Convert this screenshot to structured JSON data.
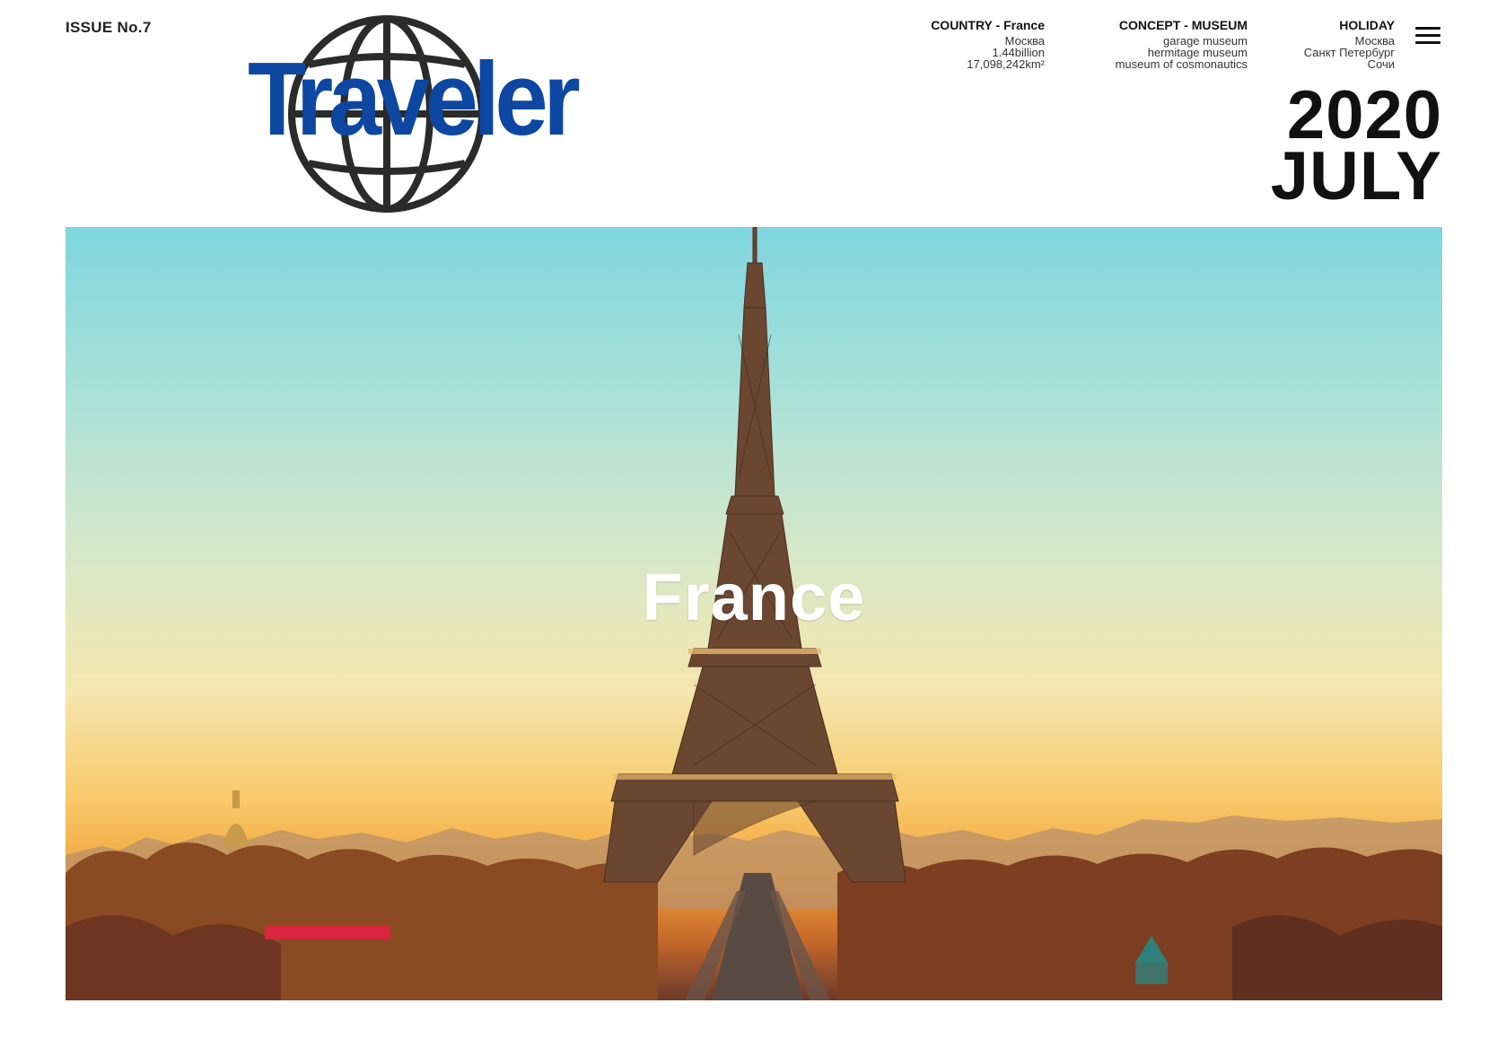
{
  "issue": "ISSUE No.7",
  "logo": {
    "text": "Traveler",
    "color": "#0d47a1"
  },
  "meta": {
    "country": {
      "title": "COUNTRY - France",
      "lines": [
        "Москва",
        "1.44billion",
        "17,098,242km²"
      ]
    },
    "concept": {
      "title": "CONCEPT - MUSEUM",
      "lines": [
        "garage museum",
        "hermitage museum",
        "museum of cosmonautics"
      ]
    },
    "holiday": {
      "title": "HOLIDAY",
      "lines": [
        "Москва",
        "Санкт Петербург",
        "Сочи"
      ]
    }
  },
  "menu": {
    "icon": "hamburger-menu-icon"
  },
  "date": {
    "year": "2020",
    "month": "JULY"
  },
  "hero": {
    "title": "France"
  }
}
